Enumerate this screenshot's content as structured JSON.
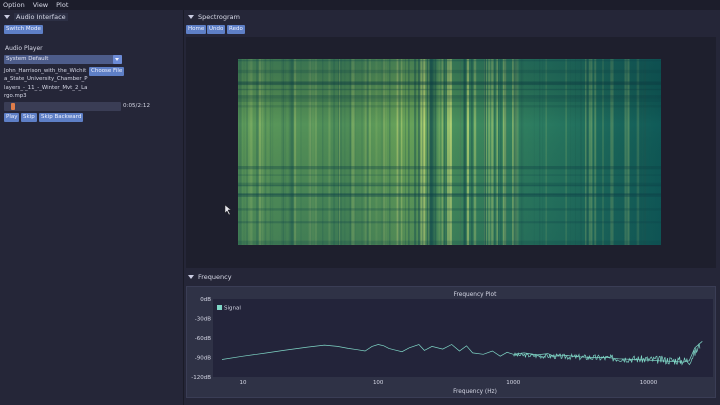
{
  "menubar": {
    "items": [
      "Option",
      "View",
      "Plot"
    ]
  },
  "audio_panel": {
    "title": "Audio Interface",
    "switch_mode_label": "Switch Mode",
    "player_title": "Audio Player",
    "device_value": "System Default",
    "choose_file_label": "Choose File",
    "filename": "John_Harrison_with_the_Wichita_State_University_Chamber_Players_-_11_-_Winter_Mvt_2_Largo.mp3",
    "progress": 0.06,
    "time_display": "0:05/2:12",
    "play_label": "Play",
    "skip_label": "Skip",
    "skip_backward_label": "Skip Backward"
  },
  "spectrogram_panel": {
    "title": "Spectrogram",
    "buttons": [
      "Home",
      "Undo",
      "Redo"
    ]
  },
  "frequency_panel": {
    "title": "Frequency"
  },
  "colors": {
    "accent": "#5e7fc6",
    "signal": "#7fd6c6",
    "background": "#252638",
    "spectrogram_low": "#0e4e4e",
    "spectrogram_high": "#c8e07a"
  },
  "chart_data": {
    "type": "line",
    "title": "Frequency Plot",
    "xlabel": "Frequency (Hz)",
    "ylabel": "",
    "x_scale": "log",
    "xlim": [
      6,
      30000
    ],
    "ylim": [
      -120,
      0
    ],
    "x_ticks": [
      "10",
      "100",
      "1000",
      "10000"
    ],
    "y_ticks": [
      "0dB",
      "-30dB",
      "-60dB",
      "-90dB",
      "-120dB"
    ],
    "legend": "top-left",
    "grid": false,
    "series": [
      {
        "name": "Signal",
        "x": [
          7,
          10,
          15,
          20,
          30,
          40,
          50,
          60,
          70,
          80,
          90,
          100,
          110,
          120,
          130,
          150,
          170,
          200,
          220,
          250,
          300,
          350,
          400,
          450,
          500,
          600,
          700,
          800,
          900,
          1000,
          1200,
          1500,
          1800,
          2000,
          2500,
          3000,
          4000,
          5000,
          6000,
          8000,
          10000,
          12000,
          15000,
          18000,
          20000,
          22000,
          25000
        ],
        "values": [
          -93,
          -88,
          -83,
          -79,
          -74,
          -71,
          -73,
          -76,
          -78,
          -80,
          -73,
          -70,
          -72,
          -76,
          -78,
          -81,
          -75,
          -70,
          -79,
          -73,
          -77,
          -70,
          -80,
          -72,
          -83,
          -85,
          -80,
          -88,
          -82,
          -85,
          -83,
          -86,
          -84,
          -88,
          -87,
          -89,
          -90,
          -90,
          -92,
          -93,
          -94,
          -95,
          -96,
          -97,
          -95,
          -75,
          -65
        ]
      }
    ]
  }
}
